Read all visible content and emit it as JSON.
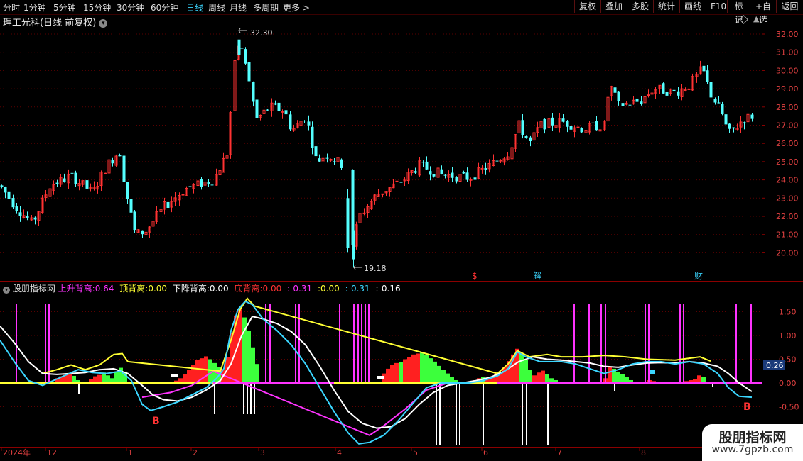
{
  "toolbar": {
    "periods": [
      "分时",
      "1分钟",
      "5分钟",
      "15分钟",
      "30分钟",
      "60分钟",
      "日线",
      "周线",
      "月线",
      "多周期",
      "更多 >"
    ],
    "active_period": "日线",
    "buttons": [
      "复权",
      "叠加",
      "多股",
      "统计",
      "画线",
      "F10",
      "标记",
      "+自选",
      "返回"
    ]
  },
  "chart_title": "理工光科(日线 前复权)",
  "price_axis": [
    "32.00",
    "31.00",
    "30.00",
    "29.00",
    "28.00",
    "27.00",
    "26.00",
    "25.00",
    "24.00",
    "23.00",
    "22.00",
    "21.00",
    "20.00"
  ],
  "price_markers": {
    "high": "32.30",
    "low": "19.18"
  },
  "event_markers": [
    {
      "label": "$",
      "color": "#ff3333"
    },
    {
      "label": "解",
      "color": "#3bd6ff"
    },
    {
      "label": "财",
      "color": "#3bd6ff"
    }
  ],
  "indicator": {
    "name": "股朋指标网",
    "items": [
      {
        "label": "上升背离:",
        "value": "0.64",
        "color": "#ff33ff"
      },
      {
        "label": "顶背离:",
        "value": "0.00",
        "color": "#ffff33"
      },
      {
        "label": "下降背离:",
        "value": "0.00",
        "color": "#ffffff"
      },
      {
        "label": "底背离:",
        "value": "0.00",
        "color": "#ff3333"
      },
      {
        "label": ":",
        "value": "-0.31",
        "color": "#ff33ff"
      },
      {
        "label": ":",
        "value": "0.00",
        "color": "#ffff33"
      },
      {
        "label": ":",
        "value": "-0.31",
        "color": "#3bd6ff"
      },
      {
        "label": ":",
        "value": "-0.16",
        "color": "#ffffff"
      }
    ],
    "axis": [
      "1.50",
      "1.00",
      "0.50",
      "0.00",
      "-0.50"
    ],
    "current_value": "0.26",
    "signals": [
      "B",
      "B"
    ]
  },
  "time_axis": [
    "2024年",
    "12",
    "1",
    "2",
    "3",
    "4",
    "5",
    "6",
    "7",
    "8"
  ],
  "watermark": {
    "title": "股朋指标网",
    "url": "www.7gpzb.com"
  }
}
